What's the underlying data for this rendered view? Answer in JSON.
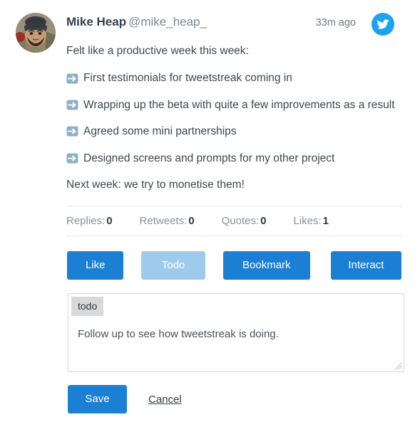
{
  "tweet": {
    "author_name": "Mike Heap",
    "author_handle": "@mike_heap_",
    "time_ago": "33m ago",
    "source_icon": "twitter-bird-icon",
    "avatar_icon": "user-avatar-photo",
    "intro_line": "Felt like a productive week this week:",
    "bullets": [
      {
        "emoji": "right-arrow-emoji",
        "text": "First testimonials for tweetstreak coming in"
      },
      {
        "emoji": "right-arrow-emoji",
        "text": "Wrapping up the beta with quite a few improvements as a result"
      },
      {
        "emoji": "right-arrow-emoji",
        "text": "Agreed some mini partnerships"
      },
      {
        "emoji": "right-arrow-emoji",
        "text": "Designed screens and prompts for my other project"
      }
    ],
    "closing_line": "Next week: we try to monetise them!"
  },
  "stats": [
    {
      "label": "Replies:",
      "value": "0"
    },
    {
      "label": "Retweets:",
      "value": "0"
    },
    {
      "label": "Quotes:",
      "value": "0"
    },
    {
      "label": "Likes:",
      "value": "1"
    }
  ],
  "actions": {
    "like_label": "Like",
    "todo_label": "Todo",
    "bookmark_label": "Bookmark",
    "interact_label": "Interact"
  },
  "note_editor": {
    "tag_label": "todo",
    "value": "Follow up to see how tweetstreak is doing.",
    "placeholder": ""
  },
  "footer": {
    "save_label": "Save",
    "cancel_label": "Cancel"
  },
  "colors": {
    "primary_blue": "#1b7fd4",
    "muted_blue": "#9ecbec",
    "twitter_blue": "#1da1f2",
    "text_dark": "#3d4852",
    "text_muted": "#8a929b",
    "tag_gray": "#d9d9d9",
    "arrow_emoji_blue": "#8eb0c4"
  }
}
